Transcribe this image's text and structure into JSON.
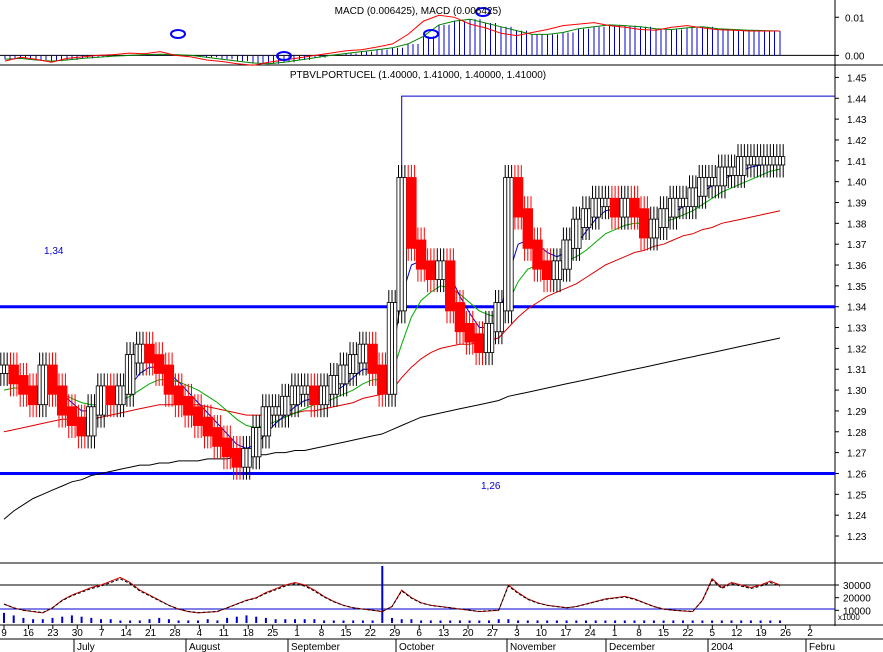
{
  "chart_data": [
    {
      "type": "line",
      "panel": "macd",
      "title": "MACD (0.006425), MACD (0.006425)",
      "yticks": [
        "0.01",
        "0.00"
      ],
      "ylim": [
        -0.002,
        0.014
      ],
      "series": [
        {
          "color": "#008000",
          "values": [
            -0.001,
            -0.0008,
            -0.0012,
            -0.0015,
            -0.0012,
            -0.0008,
            -0.0005,
            -0.0002,
            0.0,
            0.0002,
            0.0003,
            0.0002,
            0.0,
            -0.0005,
            -0.001,
            -0.0015,
            -0.002,
            -0.0022,
            -0.0018,
            -0.0012,
            -0.0006,
            0.0,
            0.0005,
            0.001,
            0.0015,
            0.002,
            0.003,
            0.005,
            0.008,
            0.009,
            0.0095,
            0.0085,
            0.0075,
            0.0065,
            0.0055,
            0.0055,
            0.006,
            0.007,
            0.0075,
            0.008,
            0.0078,
            0.0075,
            0.007,
            0.0068,
            0.0072,
            0.0075,
            0.007,
            0.0068,
            0.0066,
            0.0065,
            0.0064
          ]
        },
        {
          "color": "#ff0000",
          "values": [
            -0.0015,
            -0.0005,
            -0.001,
            -0.0018,
            -0.0008,
            -0.0004,
            0.0,
            0.0002,
            0.0006,
            0.0004,
            0.001,
            0.0,
            -0.0004,
            -0.0012,
            -0.0016,
            -0.0022,
            -0.0026,
            -0.0018,
            -0.0012,
            -0.0006,
            0.0,
            0.0006,
            0.0012,
            0.0015,
            0.0022,
            0.003,
            0.0055,
            0.009,
            0.0105,
            0.01,
            0.0082,
            0.0072,
            0.0058,
            0.0052,
            0.006,
            0.0068,
            0.0078,
            0.0082,
            0.0086,
            0.0078,
            0.0074,
            0.0068,
            0.0066,
            0.0074,
            0.0078,
            0.0072,
            0.0067,
            0.0066,
            0.0064,
            0.0064,
            0.0064
          ]
        }
      ]
    },
    {
      "type": "candlestick",
      "panel": "price",
      "title": "PTBVLPORTUCEL (1.40000, 1.41000, 1.40000, 1.41000)",
      "yticks": [
        "1.45",
        "1.44",
        "1.43",
        "1.42",
        "1.41",
        "1.40",
        "1.39",
        "1.38",
        "1.37",
        "1.36",
        "1.35",
        "1.34",
        "1.33",
        "1.32",
        "1.31",
        "1.30",
        "1.29",
        "1.28",
        "1.27",
        "1.26",
        "1.25",
        "1.24",
        "1.23"
      ],
      "ylim": [
        1.218,
        1.455
      ],
      "support_lines": [
        {
          "label": "1,34",
          "value": 1.34
        },
        {
          "label": "1,26",
          "value": 1.26
        }
      ],
      "closes": [
        1.31,
        1.305,
        1.3,
        1.295,
        1.31,
        1.3,
        1.29,
        1.285,
        1.28,
        1.29,
        1.3,
        1.295,
        1.3,
        1.315,
        1.32,
        1.315,
        1.31,
        1.3,
        1.295,
        1.29,
        1.285,
        1.28,
        1.275,
        1.27,
        1.265,
        1.27,
        1.28,
        1.29,
        1.29,
        1.295,
        1.3,
        1.3,
        1.295,
        1.3,
        1.305,
        1.31,
        1.315,
        1.32,
        1.31,
        1.3,
        1.34,
        1.4,
        1.37,
        1.36,
        1.355,
        1.36,
        1.34,
        1.33,
        1.325,
        1.32,
        1.33,
        1.34,
        1.4,
        1.385,
        1.37,
        1.36,
        1.355,
        1.36,
        1.37,
        1.38,
        1.385,
        1.39,
        1.39,
        1.385,
        1.39,
        1.385,
        1.375,
        1.38,
        1.385,
        1.39,
        1.39,
        1.395,
        1.4,
        1.4,
        1.405,
        1.405,
        1.41,
        1.41,
        1.41,
        1.41,
        1.41
      ],
      "ma_short": [
        1.31,
        1.308,
        1.304,
        1.3,
        1.302,
        1.301,
        1.298,
        1.294,
        1.29,
        1.29,
        1.292,
        1.294,
        1.297,
        1.302,
        1.308,
        1.311,
        1.311,
        1.308,
        1.304,
        1.299,
        1.294,
        1.289,
        1.284,
        1.279,
        1.274,
        1.272,
        1.274,
        1.279,
        1.284,
        1.288,
        1.292,
        1.295,
        1.296,
        1.297,
        1.299,
        1.302,
        1.306,
        1.31,
        1.31,
        1.308,
        1.315,
        1.345,
        1.36,
        1.362,
        1.36,
        1.36,
        1.355,
        1.345,
        1.337,
        1.33,
        1.33,
        1.333,
        1.355,
        1.37,
        1.372,
        1.37,
        1.366,
        1.364,
        1.366,
        1.37,
        1.376,
        1.382,
        1.386,
        1.387,
        1.388,
        1.387,
        1.383,
        1.381,
        1.382,
        1.385,
        1.388,
        1.391,
        1.395,
        1.398,
        1.401,
        1.403,
        1.405,
        1.407,
        1.408,
        1.409,
        1.41
      ],
      "ma_mid": [
        1.3,
        1.301,
        1.301,
        1.3,
        1.3,
        1.3,
        1.298,
        1.296,
        1.294,
        1.293,
        1.293,
        1.294,
        1.295,
        1.297,
        1.3,
        1.303,
        1.305,
        1.305,
        1.304,
        1.302,
        1.3,
        1.297,
        1.294,
        1.29,
        1.286,
        1.283,
        1.282,
        1.283,
        1.285,
        1.287,
        1.289,
        1.291,
        1.293,
        1.294,
        1.296,
        1.298,
        1.3,
        1.303,
        1.305,
        1.305,
        1.308,
        1.322,
        1.335,
        1.343,
        1.347,
        1.35,
        1.349,
        1.346,
        1.342,
        1.338,
        1.336,
        1.335,
        1.342,
        1.352,
        1.358,
        1.36,
        1.361,
        1.361,
        1.362,
        1.364,
        1.367,
        1.371,
        1.375,
        1.377,
        1.379,
        1.38,
        1.38,
        1.38,
        1.381,
        1.382,
        1.384,
        1.386,
        1.389,
        1.392,
        1.395,
        1.397,
        1.399,
        1.401,
        1.403,
        1.405,
        1.406
      ],
      "ma_long": [
        1.28,
        1.281,
        1.282,
        1.283,
        1.284,
        1.285,
        1.286,
        1.286,
        1.286,
        1.286,
        1.287,
        1.288,
        1.289,
        1.29,
        1.291,
        1.292,
        1.293,
        1.293,
        1.293,
        1.293,
        1.293,
        1.292,
        1.291,
        1.29,
        1.289,
        1.288,
        1.288,
        1.288,
        1.288,
        1.288,
        1.289,
        1.29,
        1.29,
        1.291,
        1.292,
        1.293,
        1.294,
        1.296,
        1.297,
        1.298,
        1.3,
        1.306,
        1.311,
        1.315,
        1.318,
        1.32,
        1.321,
        1.322,
        1.322,
        1.323,
        1.324,
        1.325,
        1.33,
        1.335,
        1.339,
        1.342,
        1.345,
        1.347,
        1.349,
        1.351,
        1.354,
        1.357,
        1.36,
        1.362,
        1.364,
        1.366,
        1.367,
        1.369,
        1.37,
        1.372,
        1.374,
        1.375,
        1.377,
        1.378,
        1.38,
        1.381,
        1.382,
        1.383,
        1.384,
        1.385,
        1.386
      ],
      "ma_very_long": [
        1.238,
        1.242,
        1.245,
        1.248,
        1.25,
        1.252,
        1.254,
        1.256,
        1.257,
        1.259,
        1.26,
        1.261,
        1.262,
        1.263,
        1.264,
        1.264,
        1.265,
        1.265,
        1.266,
        1.266,
        1.266,
        1.267,
        1.267,
        1.267,
        1.268,
        1.268,
        1.269,
        1.269,
        1.27,
        1.27,
        1.271,
        1.271,
        1.272,
        1.273,
        1.274,
        1.275,
        1.276,
        1.277,
        1.278,
        1.279,
        1.281,
        1.283,
        1.285,
        1.287,
        1.288,
        1.289,
        1.29,
        1.291,
        1.292,
        1.293,
        1.294,
        1.295,
        1.297,
        1.298,
        1.299,
        1.3,
        1.301,
        1.302,
        1.303,
        1.304,
        1.305,
        1.306,
        1.307,
        1.308,
        1.309,
        1.31,
        1.311,
        1.312,
        1.313,
        1.314,
        1.315,
        1.316,
        1.317,
        1.318,
        1.319,
        1.32,
        1.321,
        1.322,
        1.323,
        1.324,
        1.325
      ]
    },
    {
      "type": "line",
      "panel": "volume",
      "yticks": [
        "30000",
        "20000",
        "10000"
      ],
      "unit_label": "x1000",
      "ylim": [
        0,
        45000
      ],
      "series": [
        {
          "color": "#cc0000",
          "values": [
            15000,
            12000,
            10000,
            9000,
            8000,
            12000,
            18000,
            22000,
            25000,
            28000,
            30000,
            33000,
            36000,
            32000,
            26000,
            22000,
            18000,
            14000,
            11000,
            9000,
            8000,
            8500,
            9000,
            12000,
            15000,
            18000,
            20000,
            24000,
            27000,
            30000,
            32000,
            30000,
            26000,
            21000,
            17000,
            14000,
            12000,
            11000,
            10000,
            9000,
            13000,
            26000,
            20000,
            16000,
            14000,
            13000,
            12000,
            11000,
            10000,
            9000,
            9500,
            10000,
            30000,
            24000,
            19000,
            16000,
            14000,
            13000,
            12000,
            13000,
            15000,
            17000,
            19000,
            20000,
            21000,
            19000,
            16000,
            13000,
            11000,
            10000,
            9500,
            9000,
            18000,
            35000,
            28000,
            32000,
            30000,
            28000,
            30000,
            33000,
            30000
          ]
        }
      ],
      "bars": [
        8000,
        6000,
        4000,
        3000,
        3000,
        4000,
        5000,
        6000,
        5000,
        4000,
        3000,
        3000,
        2000,
        2000,
        2000,
        3000,
        4000,
        3000,
        2000,
        2000,
        2000,
        3000,
        2000,
        4000,
        5000,
        6000,
        5000,
        4000,
        3000,
        3000,
        3000,
        3000,
        3000,
        2000,
        2000,
        2000,
        2000,
        2000,
        2000,
        45000,
        4000,
        3000,
        3000,
        2000,
        2000,
        2000,
        2000,
        2000,
        2000,
        2000,
        2000,
        3000,
        3000,
        2000,
        2000,
        2000,
        2000,
        2000,
        2000,
        2000,
        2000,
        2000,
        2000,
        2000,
        2000,
        2000,
        2000,
        2000,
        2000,
        2000,
        2000,
        2000,
        2000,
        2000,
        2000,
        2000,
        2000,
        2000,
        2000,
        2000,
        2000
      ]
    }
  ],
  "x_axis": {
    "day_ticks": [
      "9",
      "16",
      "23",
      "30",
      "7",
      "14",
      "21",
      "28",
      "4",
      "11",
      "18",
      "25",
      "1",
      "8",
      "15",
      "22",
      "29",
      "6",
      "13",
      "20",
      "27",
      "3",
      "10",
      "17",
      "24",
      "1",
      "8",
      "15",
      "22",
      "5",
      "12",
      "19",
      "26",
      "2"
    ],
    "month_labels": [
      "July",
      "August",
      "September",
      "October",
      "November",
      "December",
      "2004",
      "Febru"
    ]
  }
}
